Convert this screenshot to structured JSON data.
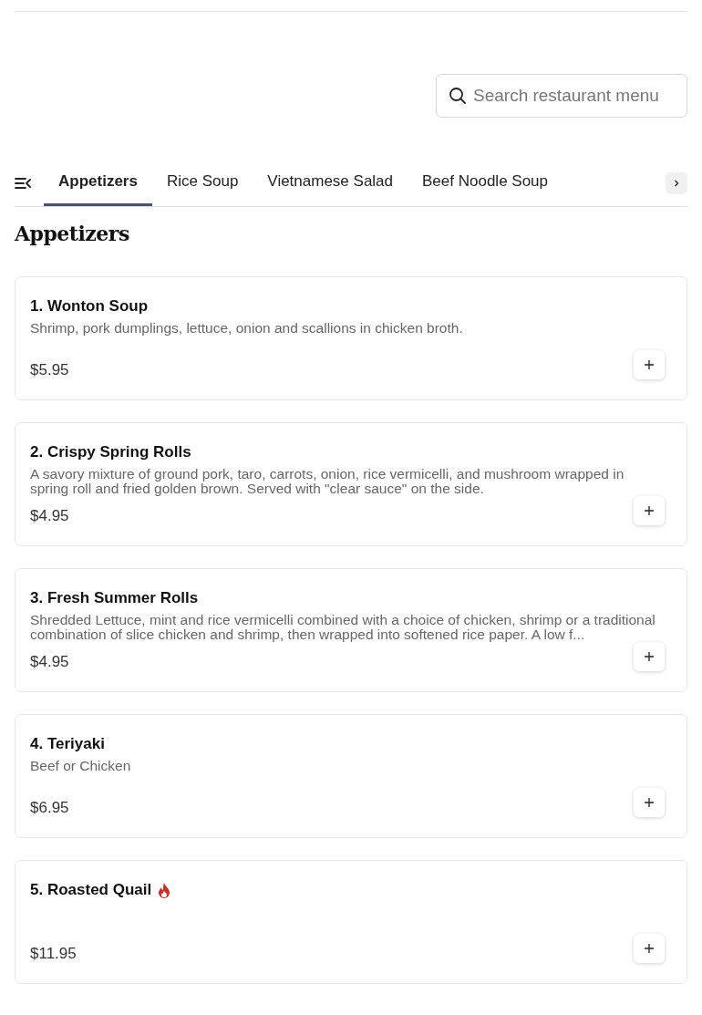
{
  "search": {
    "placeholder": "Search restaurant menu"
  },
  "tabs": [
    {
      "label": "Appetizers",
      "selected": true
    },
    {
      "label": "Rice Soup",
      "selected": false
    },
    {
      "label": "Vietnamese Salad",
      "selected": false
    },
    {
      "label": "Beef Noodle Soup",
      "selected": false
    }
  ],
  "section_title": "Appetizers",
  "items": [
    {
      "name": "1. Wonton Soup",
      "description": "Shrimp, pork dumplings, lettuce, onion and scallions in chicken broth.",
      "price": "$5.95",
      "spicy": false
    },
    {
      "name": "2. Crispy Spring Rolls",
      "description": "A savory mixture of ground pork, taro, carrots, onion, rice vermicelli, and mushroom wrapped in spring roll and fried golden brown. Served with \"clear sauce\" on the side.",
      "price": "$4.95",
      "spicy": false
    },
    {
      "name": "3. Fresh Summer Rolls",
      "description": "Shredded Lettuce, mint and rice vermicelli combined with a choice of chicken, shrimp or a traditional combination of slice chicken and shrimp, then wrapped into softened rice paper. A low f...",
      "price": "$4.95",
      "spicy": false
    },
    {
      "name": "4. Teriyaki",
      "description": "Beef or Chicken",
      "price": "$6.95",
      "spicy": false
    },
    {
      "name": "5. Roasted Quail",
      "price": "$11.95",
      "spicy": true
    }
  ]
}
